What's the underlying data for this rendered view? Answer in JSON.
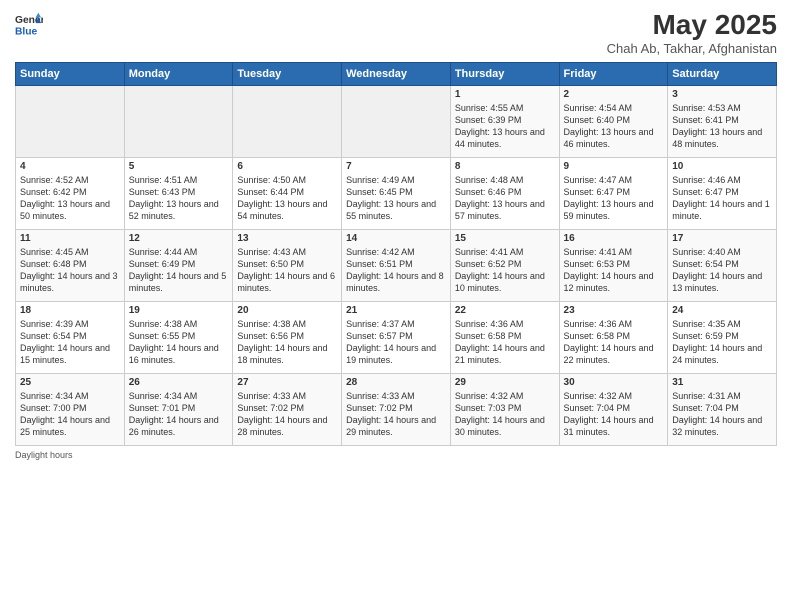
{
  "header": {
    "logo_line1": "General",
    "logo_line2": "Blue",
    "title": "May 2025",
    "subtitle": "Chah Ab, Takhar, Afghanistan"
  },
  "calendar": {
    "days_of_week": [
      "Sunday",
      "Monday",
      "Tuesday",
      "Wednesday",
      "Thursday",
      "Friday",
      "Saturday"
    ],
    "weeks": [
      [
        {
          "num": "",
          "content": ""
        },
        {
          "num": "",
          "content": ""
        },
        {
          "num": "",
          "content": ""
        },
        {
          "num": "",
          "content": ""
        },
        {
          "num": "1",
          "content": "Sunrise: 4:55 AM\nSunset: 6:39 PM\nDaylight: 13 hours and 44 minutes."
        },
        {
          "num": "2",
          "content": "Sunrise: 4:54 AM\nSunset: 6:40 PM\nDaylight: 13 hours and 46 minutes."
        },
        {
          "num": "3",
          "content": "Sunrise: 4:53 AM\nSunset: 6:41 PM\nDaylight: 13 hours and 48 minutes."
        }
      ],
      [
        {
          "num": "4",
          "content": "Sunrise: 4:52 AM\nSunset: 6:42 PM\nDaylight: 13 hours and 50 minutes."
        },
        {
          "num": "5",
          "content": "Sunrise: 4:51 AM\nSunset: 6:43 PM\nDaylight: 13 hours and 52 minutes."
        },
        {
          "num": "6",
          "content": "Sunrise: 4:50 AM\nSunset: 6:44 PM\nDaylight: 13 hours and 54 minutes."
        },
        {
          "num": "7",
          "content": "Sunrise: 4:49 AM\nSunset: 6:45 PM\nDaylight: 13 hours and 55 minutes."
        },
        {
          "num": "8",
          "content": "Sunrise: 4:48 AM\nSunset: 6:46 PM\nDaylight: 13 hours and 57 minutes."
        },
        {
          "num": "9",
          "content": "Sunrise: 4:47 AM\nSunset: 6:47 PM\nDaylight: 13 hours and 59 minutes."
        },
        {
          "num": "10",
          "content": "Sunrise: 4:46 AM\nSunset: 6:47 PM\nDaylight: 14 hours and 1 minute."
        }
      ],
      [
        {
          "num": "11",
          "content": "Sunrise: 4:45 AM\nSunset: 6:48 PM\nDaylight: 14 hours and 3 minutes."
        },
        {
          "num": "12",
          "content": "Sunrise: 4:44 AM\nSunset: 6:49 PM\nDaylight: 14 hours and 5 minutes."
        },
        {
          "num": "13",
          "content": "Sunrise: 4:43 AM\nSunset: 6:50 PM\nDaylight: 14 hours and 6 minutes."
        },
        {
          "num": "14",
          "content": "Sunrise: 4:42 AM\nSunset: 6:51 PM\nDaylight: 14 hours and 8 minutes."
        },
        {
          "num": "15",
          "content": "Sunrise: 4:41 AM\nSunset: 6:52 PM\nDaylight: 14 hours and 10 minutes."
        },
        {
          "num": "16",
          "content": "Sunrise: 4:41 AM\nSunset: 6:53 PM\nDaylight: 14 hours and 12 minutes."
        },
        {
          "num": "17",
          "content": "Sunrise: 4:40 AM\nSunset: 6:54 PM\nDaylight: 14 hours and 13 minutes."
        }
      ],
      [
        {
          "num": "18",
          "content": "Sunrise: 4:39 AM\nSunset: 6:54 PM\nDaylight: 14 hours and 15 minutes."
        },
        {
          "num": "19",
          "content": "Sunrise: 4:38 AM\nSunset: 6:55 PM\nDaylight: 14 hours and 16 minutes."
        },
        {
          "num": "20",
          "content": "Sunrise: 4:38 AM\nSunset: 6:56 PM\nDaylight: 14 hours and 18 minutes."
        },
        {
          "num": "21",
          "content": "Sunrise: 4:37 AM\nSunset: 6:57 PM\nDaylight: 14 hours and 19 minutes."
        },
        {
          "num": "22",
          "content": "Sunrise: 4:36 AM\nSunset: 6:58 PM\nDaylight: 14 hours and 21 minutes."
        },
        {
          "num": "23",
          "content": "Sunrise: 4:36 AM\nSunset: 6:58 PM\nDaylight: 14 hours and 22 minutes."
        },
        {
          "num": "24",
          "content": "Sunrise: 4:35 AM\nSunset: 6:59 PM\nDaylight: 14 hours and 24 minutes."
        }
      ],
      [
        {
          "num": "25",
          "content": "Sunrise: 4:34 AM\nSunset: 7:00 PM\nDaylight: 14 hours and 25 minutes."
        },
        {
          "num": "26",
          "content": "Sunrise: 4:34 AM\nSunset: 7:01 PM\nDaylight: 14 hours and 26 minutes."
        },
        {
          "num": "27",
          "content": "Sunrise: 4:33 AM\nSunset: 7:02 PM\nDaylight: 14 hours and 28 minutes."
        },
        {
          "num": "28",
          "content": "Sunrise: 4:33 AM\nSunset: 7:02 PM\nDaylight: 14 hours and 29 minutes."
        },
        {
          "num": "29",
          "content": "Sunrise: 4:32 AM\nSunset: 7:03 PM\nDaylight: 14 hours and 30 minutes."
        },
        {
          "num": "30",
          "content": "Sunrise: 4:32 AM\nSunset: 7:04 PM\nDaylight: 14 hours and 31 minutes."
        },
        {
          "num": "31",
          "content": "Sunrise: 4:31 AM\nSunset: 7:04 PM\nDaylight: 14 hours and 32 minutes."
        }
      ]
    ]
  },
  "footer": {
    "text": "Daylight hours"
  }
}
